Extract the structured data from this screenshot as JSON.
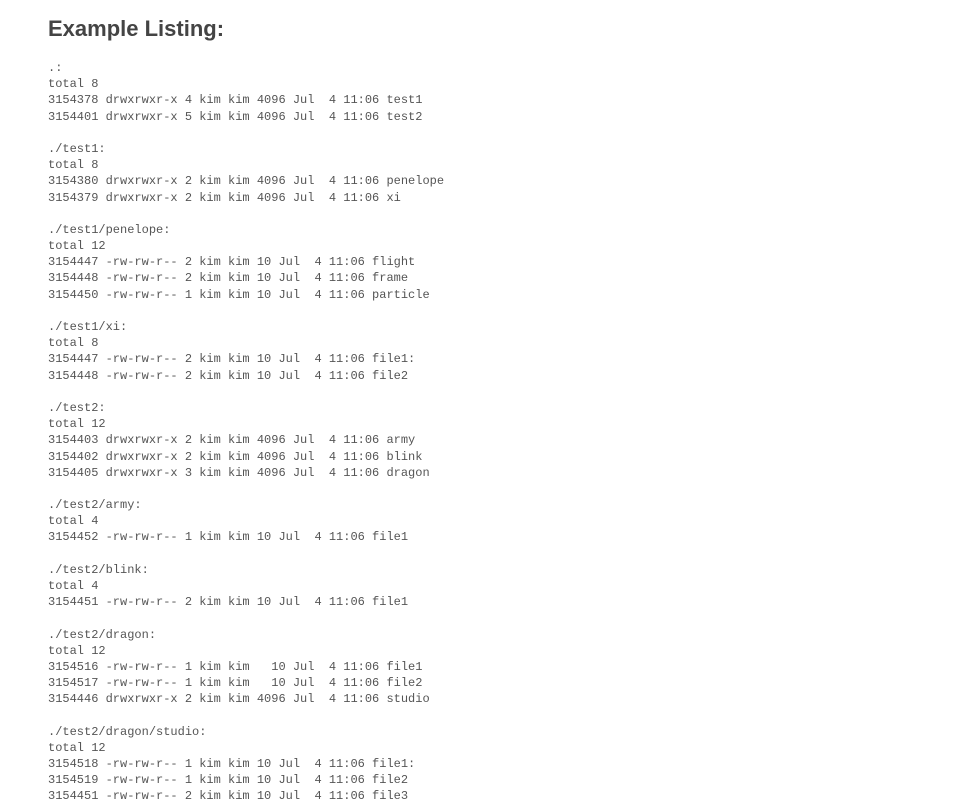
{
  "heading": "Example Listing:",
  "listing": [
    ".:",
    "total 8",
    "3154378 drwxrwxr-x 4 kim kim 4096 Jul  4 11:06 test1",
    "3154401 drwxrwxr-x 5 kim kim 4096 Jul  4 11:06 test2",
    "",
    "./test1:",
    "total 8",
    "3154380 drwxrwxr-x 2 kim kim 4096 Jul  4 11:06 penelope",
    "3154379 drwxrwxr-x 2 kim kim 4096 Jul  4 11:06 xi",
    "",
    "./test1/penelope:",
    "total 12",
    "3154447 -rw-rw-r-- 2 kim kim 10 Jul  4 11:06 flight",
    "3154448 -rw-rw-r-- 2 kim kim 10 Jul  4 11:06 frame",
    "3154450 -rw-rw-r-- 1 kim kim 10 Jul  4 11:06 particle",
    "",
    "./test1/xi:",
    "total 8",
    "3154447 -rw-rw-r-- 2 kim kim 10 Jul  4 11:06 file1:",
    "3154448 -rw-rw-r-- 2 kim kim 10 Jul  4 11:06 file2",
    "",
    "./test2:",
    "total 12",
    "3154403 drwxrwxr-x 2 kim kim 4096 Jul  4 11:06 army",
    "3154402 drwxrwxr-x 2 kim kim 4096 Jul  4 11:06 blink",
    "3154405 drwxrwxr-x 3 kim kim 4096 Jul  4 11:06 dragon",
    "",
    "./test2/army:",
    "total 4",
    "3154452 -rw-rw-r-- 1 kim kim 10 Jul  4 11:06 file1",
    "",
    "./test2/blink:",
    "total 4",
    "3154451 -rw-rw-r-- 2 kim kim 10 Jul  4 11:06 file1",
    "",
    "./test2/dragon:",
    "total 12",
    "3154516 -rw-rw-r-- 1 kim kim   10 Jul  4 11:06 file1",
    "3154517 -rw-rw-r-- 1 kim kim   10 Jul  4 11:06 file2",
    "3154446 drwxrwxr-x 2 kim kim 4096 Jul  4 11:06 studio",
    "",
    "./test2/dragon/studio:",
    "total 12",
    "3154518 -rw-rw-r-- 1 kim kim 10 Jul  4 11:06 file1:",
    "3154519 -rw-rw-r-- 1 kim kim 10 Jul  4 11:06 file2",
    "3154451 -rw-rw-r-- 2 kim kim 10 Jul  4 11:06 file3"
  ]
}
